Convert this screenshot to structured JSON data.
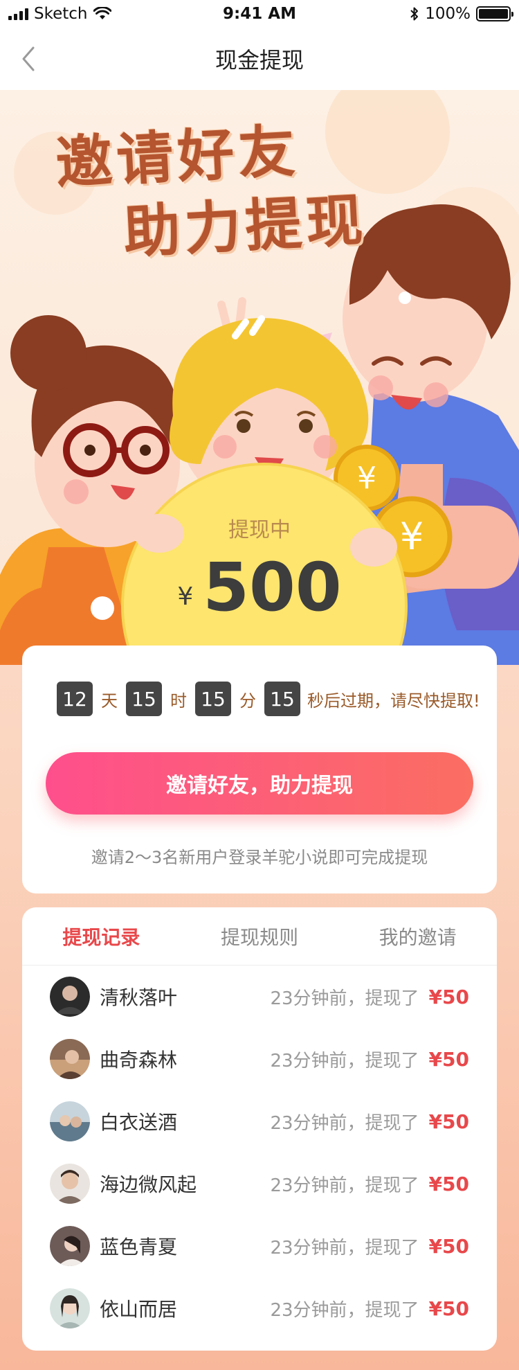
{
  "status_bar": {
    "carrier": "Sketch",
    "time": "9:41 AM",
    "battery": "100%"
  },
  "nav": {
    "title": "现金提现",
    "back_icon": "chevron-left-icon"
  },
  "hero": {
    "title_line1": "邀请好友",
    "title_line2": "助力提现",
    "coin_label": "提现中",
    "currency": "¥",
    "amount": "500"
  },
  "countdown": {
    "days": "12",
    "days_unit": "天",
    "hours": "15",
    "hours_unit": "时",
    "minutes": "15",
    "minutes_unit": "分",
    "seconds": "15",
    "tail": "秒后过期，请尽快提取!"
  },
  "invite_button": {
    "label": "邀请好友，助力提现"
  },
  "hint": "邀请2～3名新用户登录羊驼小说即可完成提现",
  "tabs": [
    {
      "label": "提现记录",
      "active": true
    },
    {
      "label": "提现规则",
      "active": false
    },
    {
      "label": "我的邀请",
      "active": false
    }
  ],
  "records": [
    {
      "name": "清秋落叶",
      "time": "23分钟前，提现了",
      "amount": "¥50",
      "avatar_color": "#2b2b2b"
    },
    {
      "name": "曲奇森林",
      "time": "23分钟前，提现了",
      "amount": "¥50",
      "avatar_color": "#8a6a55"
    },
    {
      "name": "白衣送酒",
      "time": "23分钟前，提现了",
      "amount": "¥50",
      "avatar_color": "#5f7a8c"
    },
    {
      "name": "海边微风起",
      "time": "23分钟前，提现了",
      "amount": "¥50",
      "avatar_color": "#7d6a60"
    },
    {
      "name": "蓝色青夏",
      "time": "23分钟前，提现了",
      "amount": "¥50",
      "avatar_color": "#6d5b58"
    },
    {
      "name": "依山而居",
      "time": "23分钟前，提现了",
      "amount": "¥50",
      "avatar_color": "#a7b6b3"
    }
  ],
  "colors": {
    "accent_red": "#e8484b",
    "button_gradient_start": "#fe4f8c",
    "button_gradient_end": "#fb6e62",
    "countdown_box": "#454545",
    "coin_yellow": "#fde56e"
  }
}
